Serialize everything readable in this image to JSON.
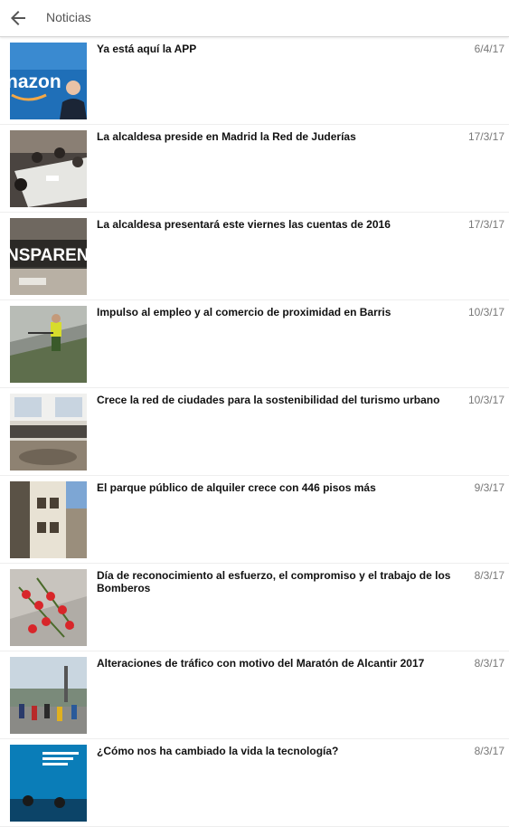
{
  "header": {
    "title": "Noticias",
    "back_icon": "arrow-left-icon"
  },
  "news": [
    {
      "title": "Ya está aquí la APP",
      "date": "6/4/17",
      "thumb": "amazon-presenter-photo",
      "thumb_text": "nazon"
    },
    {
      "title": "La alcaldesa preside en Madrid la Red de Juderías",
      "date": "17/3/17",
      "thumb": "meeting-table-photo"
    },
    {
      "title": "La alcaldesa presentará este viernes las cuentas de 2016",
      "date": "17/3/17",
      "thumb": "transparency-meeting-photo",
      "thumb_text": "NSPAREN"
    },
    {
      "title": "Impulso al empleo y al comercio de proximidad en Barris",
      "date": "10/3/17",
      "thumb": "street-worker-photo"
    },
    {
      "title": "Crece la red de ciudades para la sostenibilidad del turismo urbano",
      "date": "10/3/17",
      "thumb": "conference-room-photo"
    },
    {
      "title": "El parque público de alquiler crece con 446 pisos más",
      "date": "9/3/17",
      "thumb": "apartment-building-photo"
    },
    {
      "title": "Día de reconocimiento al esfuerzo, el compromiso y el trabajo de los Bomberos",
      "date": "8/3/17",
      "thumb": "red-flowers-photo"
    },
    {
      "title": "Alteraciones de tráfico con motivo del Maratón de Alcantir 2017",
      "date": "8/3/17",
      "thumb": "marathon-runners-photo"
    },
    {
      "title": "¿Cómo nos ha cambiado la vida la tecnología?",
      "date": "8/3/17",
      "thumb": "technology-talk-photo"
    }
  ]
}
